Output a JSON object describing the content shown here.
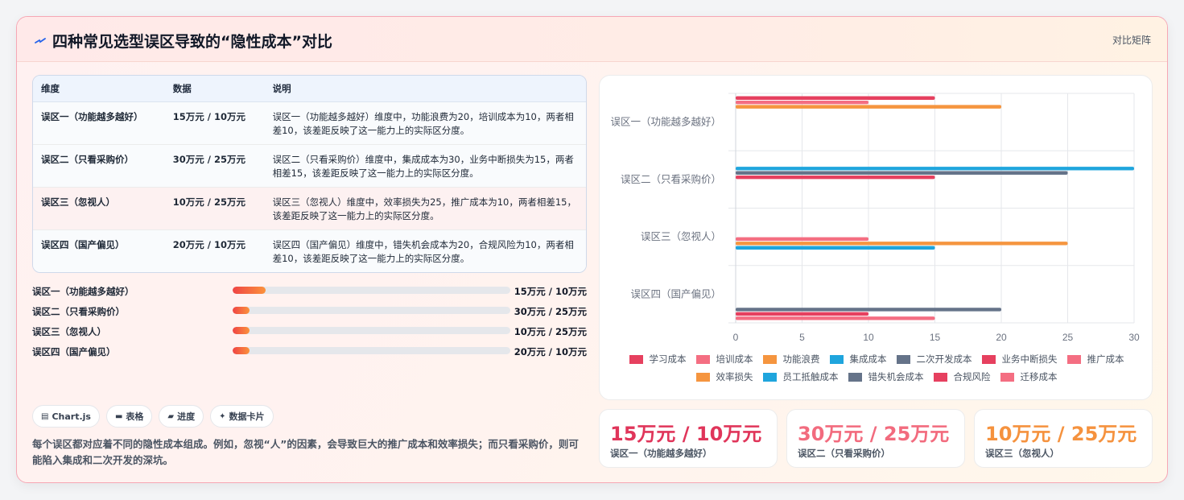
{
  "header": {
    "title": "四种常见选型误区导致的“隐性成本”对比",
    "link": "对比矩阵"
  },
  "table": {
    "headers": [
      "维度",
      "数据",
      "说明"
    ],
    "rows": [
      {
        "dim": "误区一（功能越多越好）",
        "data": "15万元 / 10万元",
        "desc": "误区一（功能越多越好）维度中，功能浪费为20，培训成本为10，两者相差10，该差距反映了这一能力上的实际区分度。"
      },
      {
        "dim": "误区二（只看采购价）",
        "data": "30万元 / 25万元",
        "desc": "误区二（只看采购价）维度中，集成成本为30，业务中断损失为15，两者相差15，该差距反映了这一能力上的实际区分度。"
      },
      {
        "dim": "误区三（忽视人）",
        "data": "10万元 / 25万元",
        "desc": "误区三（忽视人）维度中，效率损失为25，推广成本为10，两者相差15，该差距反映了这一能力上的实际区分度。"
      },
      {
        "dim": "误区四（国产偏见）",
        "data": "20万元 / 10万元",
        "desc": "误区四（国产偏见）维度中，错失机会成本为20，合规风险为10，两者相差10，该差距反映了这一能力上的实际区分度。"
      }
    ]
  },
  "progress": [
    {
      "label": "误区一（功能越多越好）",
      "value": "15万元 / 10万元",
      "fraction": 0.12
    },
    {
      "label": "误区二（只看采购价）",
      "value": "30万元 / 25万元",
      "fraction": 0.06
    },
    {
      "label": "误区三（忽视人）",
      "value": "10万元 / 25万元",
      "fraction": 0.06
    },
    {
      "label": "误区四（国产偏见）",
      "value": "20万元 / 10万元",
      "fraction": 0.06
    }
  ],
  "tags": [
    {
      "icon": "chart-icon",
      "label": "Chart.js"
    },
    {
      "icon": "table-icon",
      "label": "表格"
    },
    {
      "icon": "folder-icon",
      "label": "进度"
    },
    {
      "icon": "sparkle-icon",
      "label": "数据卡片"
    }
  ],
  "note": "每个误区都对应着不同的隐性成本组成。例如，忽视“人”的因素，会导致巨大的推广成本和效率损失；而只看采购价，则可能陷入集成和二次开发的深坑。",
  "stats": [
    {
      "value": "15万元 / 10万元",
      "label": "误区一（功能越多越好）",
      "color": "#e0355a"
    },
    {
      "value": "30万元 / 25万元",
      "label": "误区二（只看采购价）",
      "color": "#f26b7e"
    },
    {
      "value": "10万元 / 25万元",
      "label": "误区三（忽视人）",
      "color": "#f5923e"
    }
  ],
  "chart_data": {
    "type": "bar",
    "orientation": "horizontal",
    "categories": [
      "误区一（功能越多越好）",
      "误区二（只看采购价）",
      "误区三（忽视人）",
      "误区四（国产偏见）"
    ],
    "xlim": [
      0,
      30
    ],
    "xticks": [
      0,
      5,
      10,
      15,
      20,
      25,
      30
    ],
    "grid": true,
    "legend_position": "bottom",
    "series": [
      {
        "name": "学习成本",
        "color": "#e6405f",
        "values": [
          15,
          null,
          null,
          null
        ]
      },
      {
        "name": "培训成本",
        "color": "#f46e82",
        "values": [
          10,
          null,
          null,
          null
        ]
      },
      {
        "name": "功能浪费",
        "color": "#f5953f",
        "values": [
          20,
          null,
          null,
          null
        ]
      },
      {
        "name": "集成成本",
        "color": "#1fa5dd",
        "values": [
          null,
          30,
          null,
          null
        ]
      },
      {
        "name": "二次开发成本",
        "color": "#657389",
        "values": [
          null,
          25,
          null,
          null
        ]
      },
      {
        "name": "业务中断损失",
        "color": "#e6405f",
        "values": [
          null,
          15,
          null,
          null
        ]
      },
      {
        "name": "推广成本",
        "color": "#f46e82",
        "values": [
          null,
          null,
          10,
          null
        ]
      },
      {
        "name": "效率损失",
        "color": "#f5953f",
        "values": [
          null,
          null,
          25,
          null
        ]
      },
      {
        "name": "员工抵触成本",
        "color": "#1fa5dd",
        "values": [
          null,
          null,
          15,
          null
        ]
      },
      {
        "name": "错失机会成本",
        "color": "#657389",
        "values": [
          null,
          null,
          null,
          20
        ]
      },
      {
        "name": "合规风险",
        "color": "#e6405f",
        "values": [
          null,
          null,
          null,
          10
        ]
      },
      {
        "name": "迁移成本",
        "color": "#f46e82",
        "values": [
          null,
          null,
          null,
          15
        ]
      }
    ]
  }
}
